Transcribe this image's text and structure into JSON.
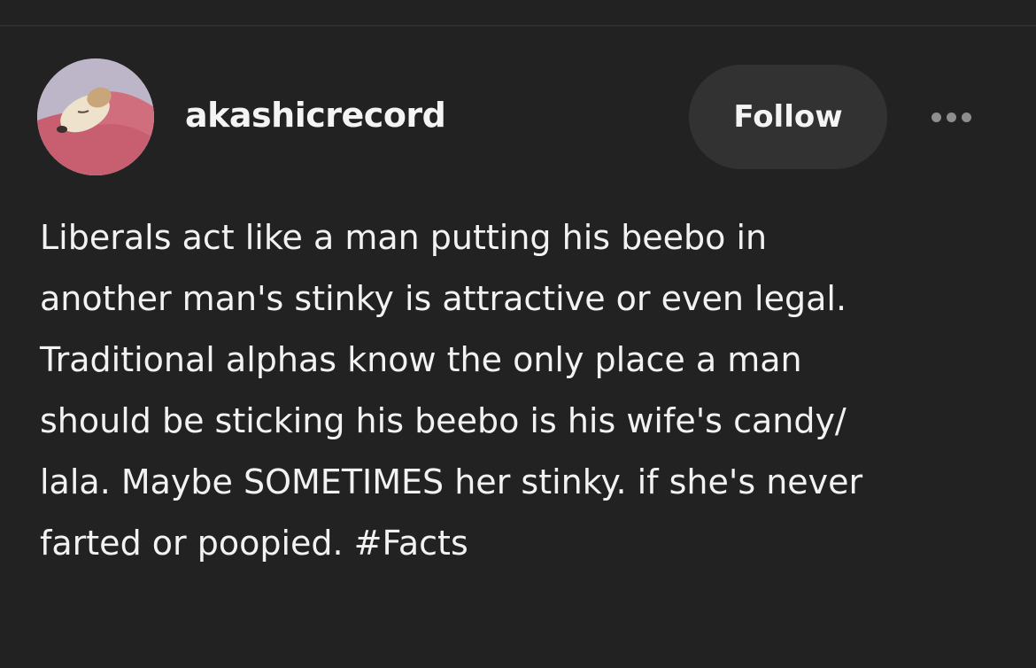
{
  "post": {
    "author": {
      "username": "akashicrecord",
      "avatar_icon": "sleeping-dog-avatar"
    },
    "follow_label": "Follow",
    "more_icon": "more-horizontal-icon",
    "body_lines": [
      "Liberals act like a man putting his beebo in",
      "another man's stinky is attractive or even legal.",
      "Traditional alphas know the only place a man",
      "should be sticking his beebo is his wife's candy/",
      "lala. Maybe SOMETIMES her stinky. if she's never",
      "farted or poopied. #Facts"
    ]
  },
  "colors": {
    "background": "#222222",
    "text": "#f2f2f2",
    "button_bg": "#323232",
    "muted_icon": "#8e8e8e"
  }
}
